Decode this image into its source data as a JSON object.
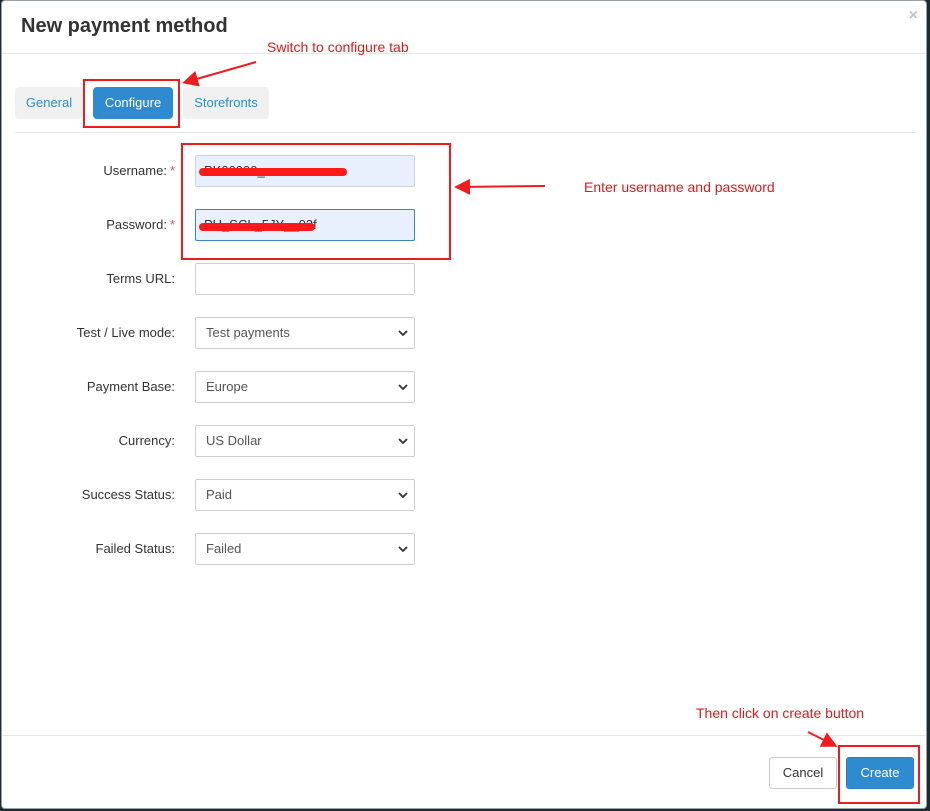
{
  "modal": {
    "title": "New payment method",
    "close_glyph": "×"
  },
  "tabs": [
    {
      "label": "General",
      "active": false
    },
    {
      "label": "Configure",
      "active": true
    },
    {
      "label": "Storefronts",
      "active": false
    }
  ],
  "form": {
    "required_mark": "*",
    "username": {
      "label": "Username:",
      "value": "PK00000_"
    },
    "password": {
      "label": "Password:",
      "value": "PU_SCL_5JY__03f"
    },
    "terms_url": {
      "label": "Terms URL:",
      "value": ""
    },
    "test_live_mode": {
      "label": "Test / Live mode:",
      "selected": "Test payments"
    },
    "payment_base": {
      "label": "Payment Base:",
      "selected": "Europe"
    },
    "currency": {
      "label": "Currency:",
      "selected": "US Dollar"
    },
    "success_status": {
      "label": "Success Status:",
      "selected": "Paid"
    },
    "failed_status": {
      "label": "Failed Status:",
      "selected": "Failed"
    }
  },
  "footer": {
    "cancel_label": "Cancel",
    "create_label": "Create"
  },
  "annotations": {
    "switch_tab": "Switch to configure tab",
    "enter_credentials": "Enter username and password",
    "click_create": "Then click on create button"
  },
  "colors": {
    "primary": "#2e8bd0",
    "annotation": "#ee1c1c",
    "required": "#d9534f"
  },
  "icons": {
    "close": "close-icon",
    "select_chevron": "chevron-down-icon"
  }
}
